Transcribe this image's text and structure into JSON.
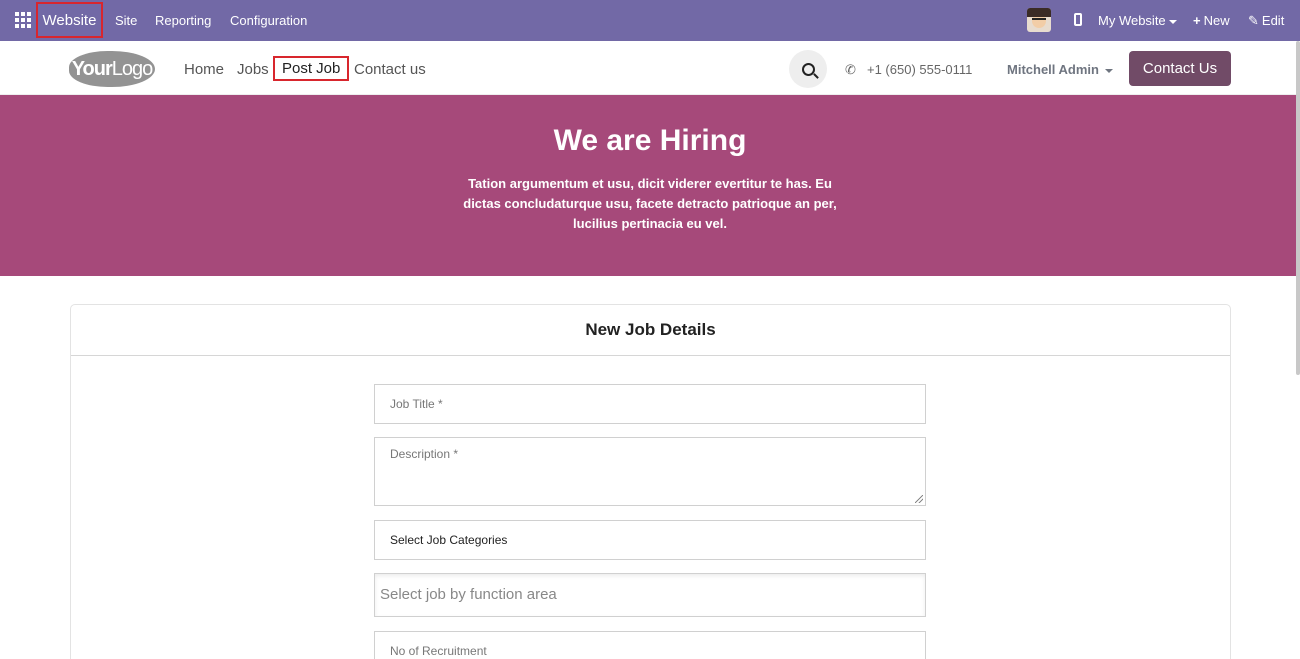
{
  "topbar": {
    "brand": "Website",
    "menu": [
      "Site",
      "Reporting",
      "Configuration"
    ],
    "my_website": "My Website",
    "new": "New",
    "edit": "Edit",
    "color": "#7269a6"
  },
  "header": {
    "logo_bold": "Your",
    "logo_light": "Logo",
    "nav": [
      "Home",
      "Jobs",
      "Post Job",
      "Contact us"
    ],
    "active_nav": "Post Job",
    "phone": "+1 (650) 555-0111",
    "user": "Mitchell Admin",
    "contact_button": "Contact Us",
    "contact_color": "#714b67"
  },
  "hero": {
    "title": "We are Hiring",
    "text": "Tation argumentum et usu, dicit viderer evertitur te has. Eu dictas concludaturque usu, facete detracto patrioque an per, lucilius pertinacia eu vel.",
    "color": "#a6497a"
  },
  "form": {
    "heading": "New Job Details",
    "job_title_placeholder": "Job Title *",
    "description_placeholder": "Description *",
    "categories_value": "Select Job Categories",
    "function_area_placeholder": "Select job by function area",
    "recruitment_placeholder": "No of Recruitment"
  },
  "icons": {
    "apps": "apps-grid-icon",
    "mobile": "mobile-icon",
    "search": "search-icon",
    "phone": "phone-icon"
  }
}
